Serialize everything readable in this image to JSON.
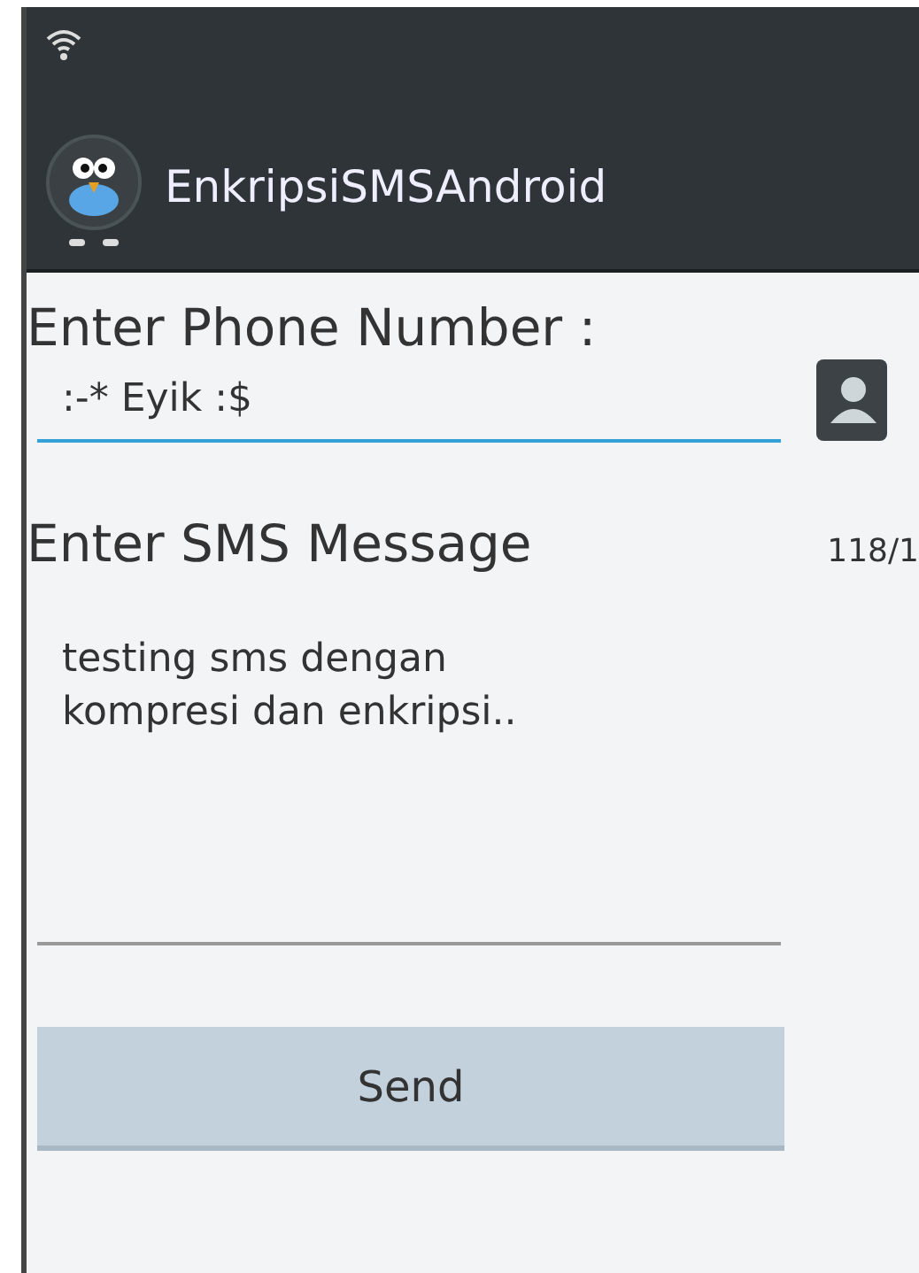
{
  "action_bar": {
    "title": "EnkripsiSMSAndroid"
  },
  "phone": {
    "label": "Enter Phone Number :",
    "value": ":-* Eyik :$",
    "focused": true
  },
  "message": {
    "label": "Enter SMS Message",
    "counter": "118/1",
    "value": "testing sms dengan\nkompresi dan enkripsi..",
    "focused": false
  },
  "buttons": [
    {
      "label": "Send"
    }
  ]
}
